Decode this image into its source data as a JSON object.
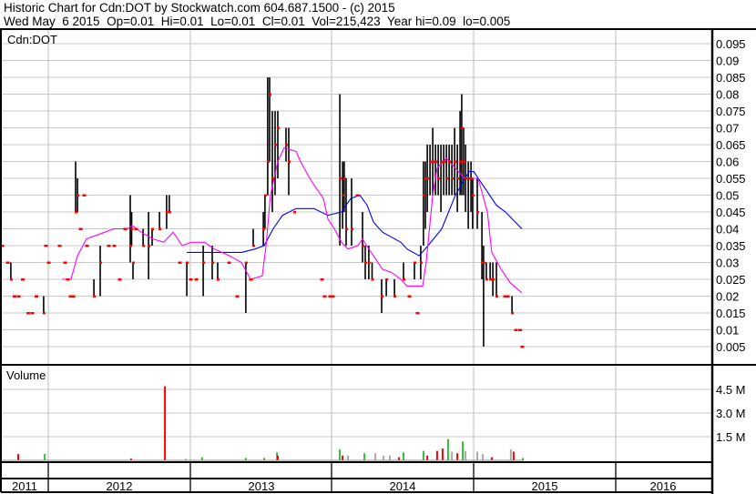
{
  "header": {
    "title": "Historic Chart for Cdn:DOT by Stockwatch.com 604.687.1500 - (c) 2015",
    "quote": "Wed May  6 2015  Op=0.01  Hi=0.01  Lo=0.01  Cl=0.01  Vol=215,423  Year hi=0.09  lo=0.005"
  },
  "colors": {
    "bar": "#000000",
    "close": "#ff0000",
    "ma_short": "#ff00ff",
    "ma_long": "#0000ff",
    "vol_up": "#33bb33",
    "vol_down": "#ff0000",
    "vol_flat": "#aaaaaa",
    "grid": "#c8c8c8"
  },
  "chart_data": [
    {
      "type": "bar",
      "title": "Cdn:DOT",
      "x_unit": "weeks since 2011-01-01",
      "ylim": [
        0,
        0.0975
      ],
      "y_ticks": [
        "0.095",
        "0.09",
        "0.085",
        "0.08",
        "0.075",
        "0.07",
        "0.065",
        "0.06",
        "0.055",
        "0.05",
        "0.045",
        "0.04",
        "0.035",
        "0.03",
        "0.025",
        "0.02",
        "0.015",
        "0.01",
        "0.005"
      ],
      "x_tick_labels": [
        "2011",
        "2012",
        "2013",
        "2014",
        "2015",
        "2016"
      ],
      "grid": true,
      "ohlc_bars": [
        [
          38.3,
          0.03,
          0.025,
          0.025
        ],
        [
          50.3,
          0.02,
          0.015,
          0.015
        ],
        [
          62,
          0.06,
          0.045,
          0.045
        ],
        [
          62.7,
          0.055,
          0.045,
          0.05
        ],
        [
          68.7,
          0.025,
          0.02,
          0.02
        ],
        [
          71,
          0.035,
          0.02,
          0.03
        ],
        [
          82,
          0.05,
          0.03,
          0.035
        ],
        [
          82.5,
          0.045,
          0.035,
          0.04
        ],
        [
          83,
          0.03,
          0.025,
          0.03
        ],
        [
          86.7,
          0.04,
          0.035,
          0.035
        ],
        [
          88.7,
          0.045,
          0.025,
          0.035
        ],
        [
          90,
          0.04,
          0.035,
          0.04
        ],
        [
          92.7,
          0.045,
          0.04,
          0.04
        ],
        [
          95.3,
          0.05,
          0.04,
          0.045
        ],
        [
          96.3,
          0.05,
          0.045,
          0.045
        ],
        [
          102.7,
          0.03,
          0.02,
          0.03
        ],
        [
          108.7,
          0.035,
          0.02,
          0.03
        ],
        [
          112,
          0.035,
          0.025,
          0.03
        ],
        [
          114,
          0.03,
          0.025,
          0.025
        ],
        [
          124.3,
          0.03,
          0.015,
          0.03
        ],
        [
          127,
          0.04,
          0.035,
          0.035
        ],
        [
          130.7,
          0.045,
          0.035,
          0.04
        ],
        [
          131.3,
          0.05,
          0.04,
          0.05
        ],
        [
          132.3,
          0.085,
          0.05,
          0.06
        ],
        [
          133,
          0.085,
          0.06,
          0.08
        ],
        [
          134,
          0.075,
          0.045,
          0.055
        ],
        [
          135,
          0.075,
          0.05,
          0.065
        ],
        [
          136,
          0.075,
          0.055,
          0.07
        ],
        [
          139,
          0.07,
          0.06,
          0.065
        ],
        [
          140,
          0.07,
          0.05,
          0.06
        ],
        [
          142,
          0.04,
          0.04,
          0.045
        ],
        [
          158.7,
          0.08,
          0.035,
          0.055
        ],
        [
          159.7,
          0.06,
          0.04,
          0.05
        ],
        [
          160.3,
          0.06,
          0.045,
          0.055
        ],
        [
          161,
          0.055,
          0.035,
          0.04
        ],
        [
          163,
          0.055,
          0.035,
          0.04
        ],
        [
          167,
          0.045,
          0.03,
          0.035
        ],
        [
          168,
          0.035,
          0.025,
          0.03
        ],
        [
          169.3,
          0.035,
          0.025,
          0.03
        ],
        [
          170.5,
          0.03,
          0.025,
          0.025
        ],
        [
          174,
          0.025,
          0.015,
          0.02
        ],
        [
          175.7,
          0.025,
          0.02,
          0.025
        ],
        [
          178.7,
          0.025,
          0.02,
          0.02
        ],
        [
          182,
          0.03,
          0.025,
          0.025
        ],
        [
          186,
          0.03,
          0.025,
          0.03
        ],
        [
          188.3,
          0.035,
          0.025,
          0.03
        ],
        [
          189.3,
          0.06,
          0.035,
          0.05
        ],
        [
          190,
          0.06,
          0.04,
          0.055
        ],
        [
          190.7,
          0.065,
          0.045,
          0.055
        ],
        [
          191.7,
          0.065,
          0.05,
          0.06
        ],
        [
          192.7,
          0.07,
          0.05,
          0.06
        ],
        [
          193.7,
          0.065,
          0.05,
          0.06
        ],
        [
          194.7,
          0.065,
          0.05,
          0.055
        ],
        [
          195.7,
          0.065,
          0.045,
          0.06
        ],
        [
          196.7,
          0.065,
          0.05,
          0.06
        ],
        [
          197.7,
          0.065,
          0.05,
          0.055
        ],
        [
          198.7,
          0.065,
          0.05,
          0.06
        ],
        [
          199.7,
          0.065,
          0.05,
          0.055
        ],
        [
          200.7,
          0.07,
          0.05,
          0.06
        ],
        [
          201.7,
          0.065,
          0.045,
          0.055
        ],
        [
          202.7,
          0.075,
          0.05,
          0.06
        ],
        [
          203.3,
          0.08,
          0.05,
          0.07
        ],
        [
          204,
          0.07,
          0.05,
          0.06
        ],
        [
          204.7,
          0.065,
          0.045,
          0.055
        ],
        [
          205.7,
          0.06,
          0.04,
          0.055
        ],
        [
          206.7,
          0.06,
          0.045,
          0.055
        ],
        [
          207.3,
          0.055,
          0.04,
          0.05
        ],
        [
          209,
          0.055,
          0.04,
          0.045
        ],
        [
          210.7,
          0.045,
          0.025,
          0.03
        ],
        [
          211.3,
          0.035,
          0.005,
          0.03
        ],
        [
          212.3,
          0.03,
          0.025,
          0.025
        ],
        [
          213.7,
          0.03,
          0.025,
          0.025
        ],
        [
          214.7,
          0.03,
          0.02,
          0.025
        ],
        [
          216,
          0.03,
          0.02,
          0.02
        ],
        [
          221.7,
          0.02,
          0.015,
          0.015
        ]
      ],
      "flat_closes": [
        [
          35,
          0.035
        ],
        [
          37,
          0.03
        ],
        [
          39.5,
          0.02
        ],
        [
          41,
          0.02
        ],
        [
          42.5,
          0.025
        ],
        [
          44.5,
          0.015
        ],
        [
          46,
          0.015
        ],
        [
          47.5,
          0.02
        ],
        [
          51,
          0.035
        ],
        [
          52,
          0.03
        ],
        [
          56,
          0.035
        ],
        [
          58,
          0.03
        ],
        [
          59,
          0.025
        ],
        [
          60,
          0.02
        ],
        [
          61,
          0.02
        ],
        [
          63.7,
          0.04
        ],
        [
          65,
          0.05
        ],
        [
          66,
          0.035
        ],
        [
          74,
          0.035
        ],
        [
          76,
          0.035
        ],
        [
          78,
          0.025
        ],
        [
          80,
          0.04
        ],
        [
          84,
          0.04
        ],
        [
          100,
          0.03
        ],
        [
          104,
          0.025
        ],
        [
          106,
          0.025
        ],
        [
          118,
          0.03
        ],
        [
          121,
          0.02
        ],
        [
          126,
          0.025
        ],
        [
          152,
          0.025
        ],
        [
          153,
          0.02
        ],
        [
          155,
          0.02
        ],
        [
          156,
          0.02
        ],
        [
          165,
          0.05
        ],
        [
          184,
          0.02
        ],
        [
          187,
          0.015
        ],
        [
          219,
          0.02
        ],
        [
          220,
          0.02
        ],
        [
          223,
          0.01
        ],
        [
          224.5,
          0.01
        ],
        [
          225.3,
          0.005
        ]
      ],
      "moving_average_short": [
        [
          57,
          0.025
        ],
        [
          60.3,
          0.025
        ],
        [
          62.7,
          0.032
        ],
        [
          66,
          0.037
        ],
        [
          72.7,
          0.039
        ],
        [
          76,
          0.04
        ],
        [
          81,
          0.04
        ],
        [
          82.7,
          0.041
        ],
        [
          86,
          0.039
        ],
        [
          90.3,
          0.037
        ],
        [
          94.3,
          0.036
        ],
        [
          97.7,
          0.039
        ],
        [
          101,
          0.035
        ],
        [
          104.3,
          0.036
        ],
        [
          109.3,
          0.036
        ],
        [
          112.7,
          0.034
        ],
        [
          118.3,
          0.032
        ],
        [
          122.7,
          0.03
        ],
        [
          126,
          0.025
        ],
        [
          130.3,
          0.026
        ],
        [
          131.7,
          0.035
        ],
        [
          133.3,
          0.05
        ],
        [
          136,
          0.06
        ],
        [
          138.3,
          0.064
        ],
        [
          142.7,
          0.063
        ],
        [
          144.3,
          0.06
        ],
        [
          147.7,
          0.055
        ],
        [
          149.3,
          0.053
        ],
        [
          152.7,
          0.049
        ],
        [
          154.3,
          0.043
        ],
        [
          156.7,
          0.04
        ],
        [
          159.3,
          0.036
        ],
        [
          161.7,
          0.034
        ],
        [
          165.3,
          0.035
        ],
        [
          167,
          0.037
        ],
        [
          169.3,
          0.034
        ],
        [
          171,
          0.032
        ],
        [
          174.3,
          0.028
        ],
        [
          177.7,
          0.027
        ],
        [
          181,
          0.025
        ],
        [
          183.3,
          0.023
        ],
        [
          189,
          0.023
        ],
        [
          190.3,
          0.03
        ],
        [
          192.7,
          0.05
        ],
        [
          194.3,
          0.058
        ],
        [
          197.7,
          0.061
        ],
        [
          201,
          0.058
        ],
        [
          204.3,
          0.055
        ],
        [
          209.3,
          0.055
        ],
        [
          212.7,
          0.045
        ],
        [
          214.3,
          0.033
        ],
        [
          217.7,
          0.028
        ],
        [
          221,
          0.024
        ],
        [
          225.3,
          0.021
        ]
      ],
      "moving_average_long": [
        [
          102.7,
          0.033
        ],
        [
          122.7,
          0.033
        ],
        [
          127.7,
          0.034
        ],
        [
          131,
          0.035
        ],
        [
          134.3,
          0.04
        ],
        [
          137.7,
          0.044
        ],
        [
          142.7,
          0.046
        ],
        [
          149.3,
          0.046
        ],
        [
          154.3,
          0.044
        ],
        [
          159.3,
          0.045
        ],
        [
          162.7,
          0.049
        ],
        [
          166,
          0.05
        ],
        [
          168.7,
          0.047
        ],
        [
          171,
          0.042
        ],
        [
          174.3,
          0.039
        ],
        [
          181,
          0.036
        ],
        [
          183.3,
          0.034
        ],
        [
          187.7,
          0.032
        ],
        [
          191,
          0.035
        ],
        [
          196,
          0.04
        ],
        [
          201,
          0.05
        ],
        [
          206,
          0.057
        ],
        [
          207.7,
          0.057
        ],
        [
          212.7,
          0.051
        ],
        [
          216,
          0.047
        ],
        [
          219.3,
          0.045
        ],
        [
          225.3,
          0.04
        ]
      ]
    },
    {
      "type": "bar",
      "title": "Volume",
      "unit": "M shares",
      "ylim": [
        0,
        5.7
      ],
      "y_ticks": [
        "4.5 M",
        "3.0 M",
        "1.5 M"
      ],
      "bars": [
        [
          41,
          0.4,
          "down"
        ],
        [
          50.7,
          0.4,
          "up"
        ],
        [
          82.3,
          0.12,
          "down"
        ],
        [
          94.7,
          4.7,
          "down"
        ],
        [
          102.3,
          0.1,
          "flat"
        ],
        [
          108.3,
          0.2,
          "up"
        ],
        [
          124.3,
          0.15,
          "up"
        ],
        [
          131,
          0.15,
          "up"
        ],
        [
          135.7,
          0.5,
          "up"
        ],
        [
          136,
          0.3,
          "down"
        ],
        [
          158.7,
          0.7,
          "up"
        ],
        [
          159.7,
          0.3,
          "down"
        ],
        [
          161.7,
          0.3,
          "flat"
        ],
        [
          167.7,
          0.45,
          "up"
        ],
        [
          171.7,
          0.45,
          "flat"
        ],
        [
          174.7,
          0.3,
          "flat"
        ],
        [
          177,
          0.3,
          "flat"
        ],
        [
          180.3,
          0.2,
          "down"
        ],
        [
          182,
          0.5,
          "up"
        ],
        [
          189.3,
          0.6,
          "up"
        ],
        [
          190.7,
          0.3,
          "down"
        ],
        [
          194.3,
          0.6,
          "down"
        ],
        [
          196.3,
          0.75,
          "down"
        ],
        [
          198.3,
          1.35,
          "up"
        ],
        [
          199.7,
          0.55,
          "flat"
        ],
        [
          201.7,
          0.45,
          "down"
        ],
        [
          203.7,
          1.2,
          "up"
        ],
        [
          204.7,
          0.6,
          "flat"
        ],
        [
          209,
          0.55,
          "flat"
        ],
        [
          211,
          0.4,
          "flat"
        ],
        [
          214.3,
          0.2,
          "down"
        ],
        [
          221.3,
          0.7,
          "flat"
        ],
        [
          222.3,
          0.55,
          "down"
        ],
        [
          225.7,
          0.15,
          "up"
        ]
      ]
    }
  ]
}
